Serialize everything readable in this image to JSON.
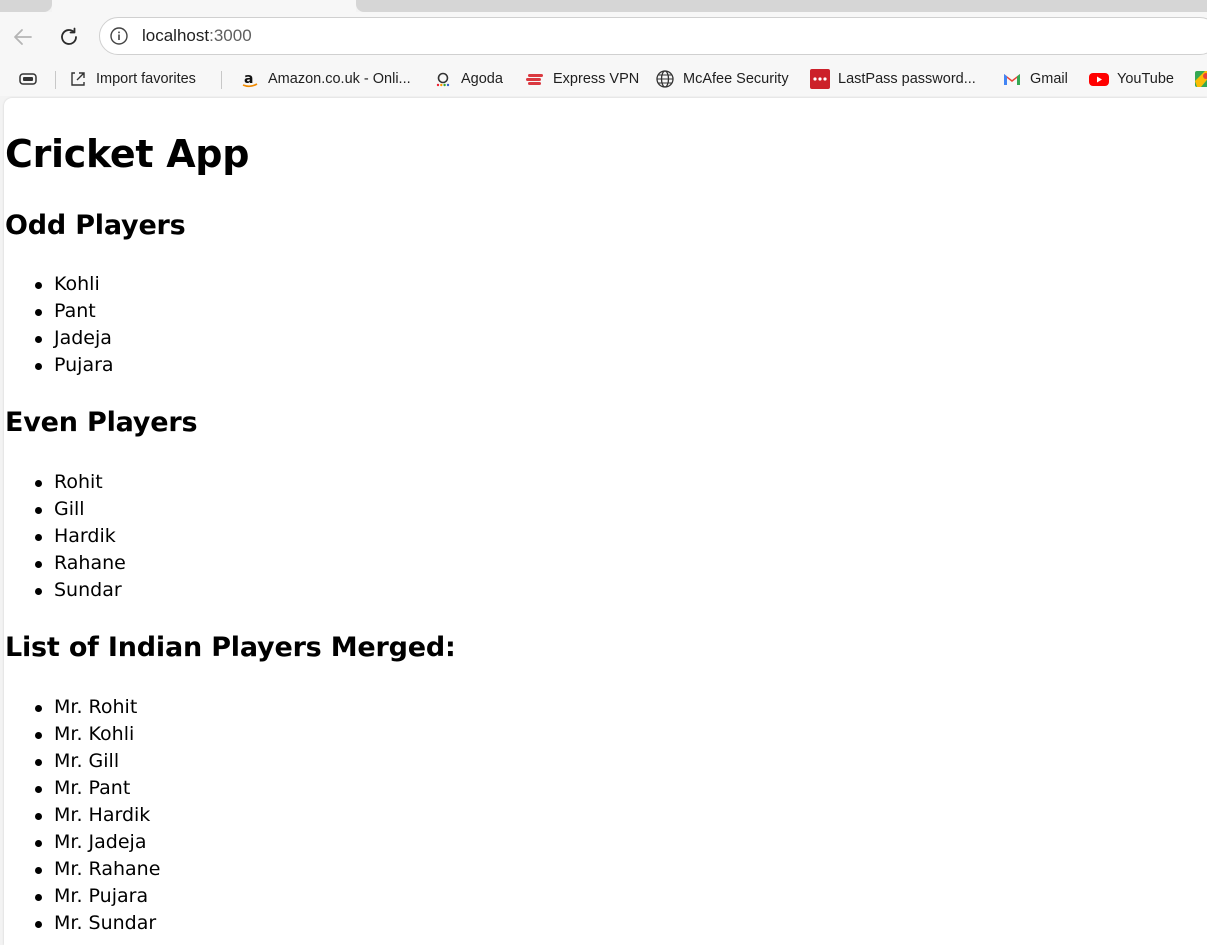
{
  "browser": {
    "url_host": "localhost",
    "url_port": ":3000",
    "bookmarks": [
      {
        "label": "Import favorites",
        "icon": "import-favorites-icon"
      },
      {
        "label": "Amazon.co.uk - Onli...",
        "icon": "amazon-icon"
      },
      {
        "label": "Agoda",
        "icon": "agoda-icon"
      },
      {
        "label": "Express VPN",
        "icon": "expressvpn-icon"
      },
      {
        "label": "McAfee Security",
        "icon": "globe-icon"
      },
      {
        "label": "LastPass password...",
        "icon": "lastpass-icon"
      },
      {
        "label": "Gmail",
        "icon": "gmail-icon"
      },
      {
        "label": "YouTube",
        "icon": "youtube-icon"
      }
    ]
  },
  "page": {
    "title": "Cricket App",
    "odd_heading": "Odd Players",
    "odd_players": [
      "Kohli",
      "Pant",
      "Jadeja",
      "Pujara"
    ],
    "even_heading": "Even Players",
    "even_players": [
      "Rohit",
      "Gill",
      "Hardik",
      "Rahane",
      "Sundar"
    ],
    "merged_heading": "List of Indian Players Merged:",
    "merged_players": [
      "Mr. Rohit",
      "Mr. Kohli",
      "Mr. Gill",
      "Mr. Pant",
      "Mr. Hardik",
      "Mr. Jadeja",
      "Mr. Rahane",
      "Mr. Pujara",
      "Mr. Sundar"
    ]
  }
}
